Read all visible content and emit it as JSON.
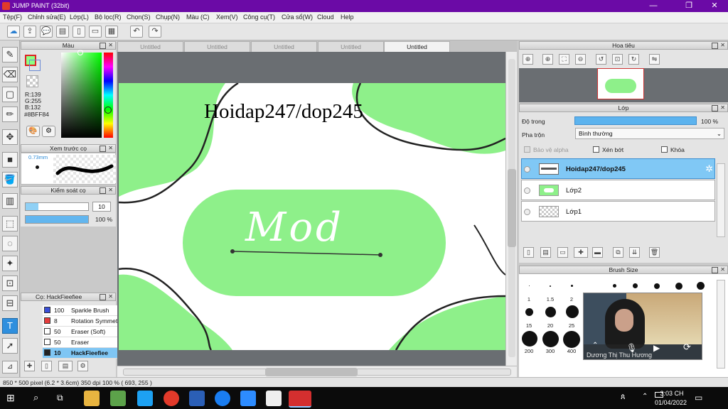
{
  "window": {
    "title": "JUMP PAINT (32bit)",
    "min": "—",
    "max": "❐",
    "close": "✕"
  },
  "menu": [
    "Tệp(F)",
    "Chỉnh sửa(E)",
    "Lớp(L)",
    "Bộ lọc(R)",
    "Chọn(S)",
    "Chụp(N)",
    "Màu (C)",
    "Xem(V)",
    "Công cụ(T)",
    "Cửa sổ(W)",
    "Cloud",
    "Help"
  ],
  "tabs": [
    "Untitled",
    "Untitled",
    "Untitled",
    "Untitled",
    "Untitled"
  ],
  "color_panel": {
    "title": "Màu",
    "r": "R:139",
    "g": "G:255",
    "b": "B:132",
    "hex": "#8BFF84",
    "fg_color": "#8bff84"
  },
  "brush_preview": {
    "title": "Xem trước cọ",
    "size": "0.73mm"
  },
  "brush_control": {
    "title": "Kiểm soát cọ",
    "size_value": "10",
    "opacity_value": "100 %"
  },
  "brush_list": {
    "title": "Cọ: HackFieefiee",
    "items": [
      {
        "num": "100",
        "name": "Sparkle Brush",
        "color": "#3a4fd8"
      },
      {
        "num": "8",
        "name": "Rotation Symmetry",
        "color": "#e53a3a"
      },
      {
        "num": "50",
        "name": "Eraser (Soft)",
        "color": "#ffffff"
      },
      {
        "num": "50",
        "name": "Eraser",
        "color": "#ffffff"
      },
      {
        "num": "10",
        "name": "HackFieefiee",
        "color": "#222222"
      }
    ]
  },
  "canvas": {
    "text": "Hoidap247/dop245",
    "logo_text": "Mod",
    "green": "#8ef08a"
  },
  "navigator": {
    "title": "Hoa tiêu"
  },
  "layers": {
    "title": "Lớp",
    "opacity_label": "Độ trong",
    "opacity_value": "100 %",
    "blend_label": "Pha trộn",
    "blend_value": "Bình thường",
    "protect_alpha": "Bảo vệ alpha",
    "clipping": "Xén bớt",
    "lock": "Khóa",
    "items": [
      {
        "name": "Hoidap247/dop245",
        "selected": true
      },
      {
        "name": "Lớp2",
        "selected": false
      },
      {
        "name": "Lớp1",
        "selected": false
      }
    ]
  },
  "brush_size": {
    "title": "Brush Size",
    "labels": [
      "1",
      "1.5",
      "2",
      "15",
      "20",
      "25",
      "200",
      "300",
      "400"
    ]
  },
  "video": {
    "caller": "Dương Thị Thu Hương"
  },
  "status": {
    "text": "850 * 500 pixel  (6.2 * 3.6cm)  350 dpi  100 %  ( 693, 255 )"
  },
  "taskbar": {
    "time": "3:03 CH",
    "date": "01/04/2022"
  }
}
